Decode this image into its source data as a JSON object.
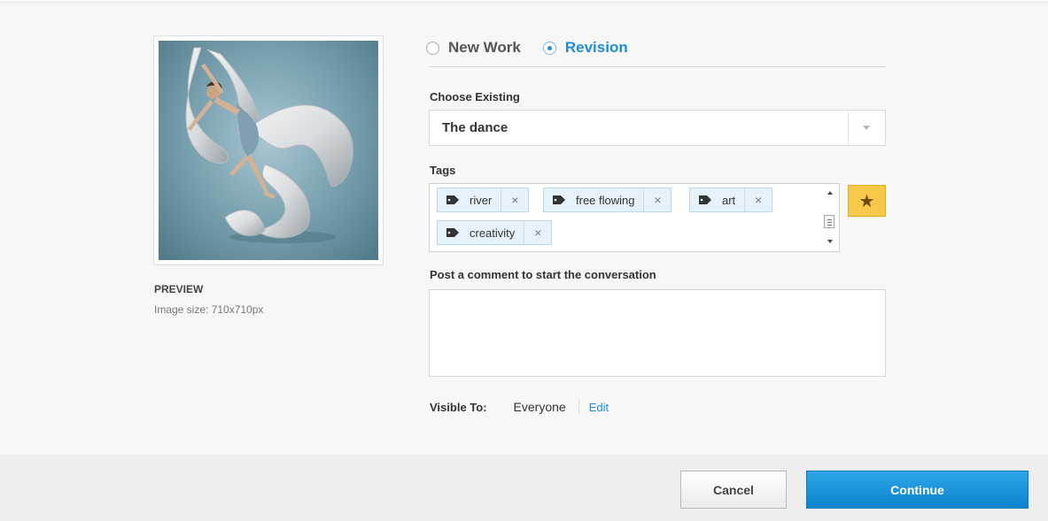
{
  "mode": {
    "options": [
      "New Work",
      "Revision"
    ],
    "selected": "Revision"
  },
  "choose_existing": {
    "label": "Choose Existing",
    "value": "The dance"
  },
  "tags": {
    "label": "Tags",
    "items": [
      "river",
      "free flowing",
      "art",
      "creativity"
    ],
    "remove_glyph": "×"
  },
  "comment": {
    "label": "Post a comment to start the conversation",
    "value": ""
  },
  "visibility": {
    "label": "Visible To:",
    "value": "Everyone",
    "edit_label": "Edit"
  },
  "preview": {
    "label": "PREVIEW",
    "size_text": "Image size: 710x710px"
  },
  "actions": {
    "cancel_label": "Cancel",
    "continue_label": "Continue"
  },
  "colors": {
    "accent": "#1b8fd3",
    "tag_bg": "#e6f2fb",
    "star_bg": "#f8c84a",
    "continue_bg": "#1592da"
  },
  "icons": [
    "tag-icon",
    "remove-icon",
    "star-icon",
    "dropdown-arrow-icon",
    "scroll-up-icon",
    "scroll-down-icon"
  ]
}
